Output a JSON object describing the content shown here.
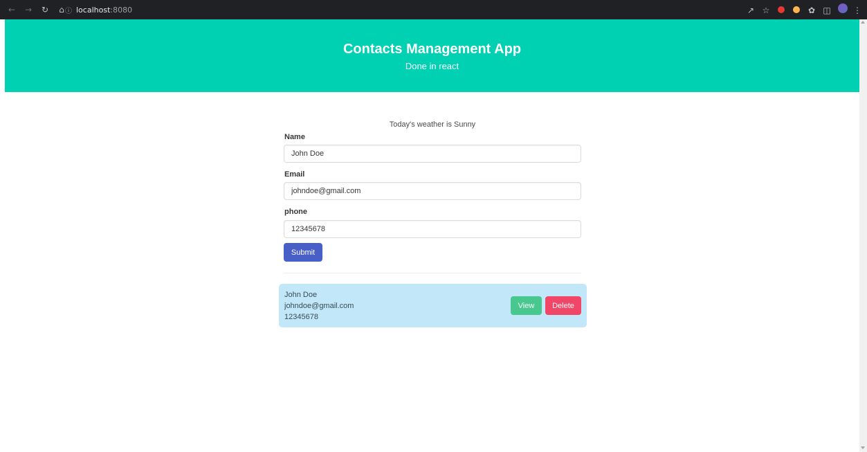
{
  "browser": {
    "url_host": "localhost",
    "url_port": ":8080",
    "icons": {
      "back": "arrow-left-icon",
      "forward": "arrow-right-icon",
      "reload": "reload-icon",
      "home": "home-icon",
      "info": "info-icon",
      "share": "share-icon",
      "bookmark": "star-icon",
      "extensions": "puzzle-icon",
      "sidepanel": "side-panel-icon",
      "menu": "kebab-menu-icon"
    }
  },
  "header": {
    "title": "Contacts Management App",
    "subtitle": "Done in react"
  },
  "weather": "Today's weather is Sunny",
  "form": {
    "name_label": "Name",
    "name_value": "John Doe",
    "email_label": "Email",
    "email_value": "johndoe@gmail.com",
    "phone_label": "phone",
    "phone_value": "12345678",
    "submit_label": "Submit"
  },
  "contacts": [
    {
      "name": "John Doe",
      "email": "johndoe@gmail.com",
      "phone": "12345678",
      "view_label": "View",
      "delete_label": "Delete"
    }
  ],
  "colors": {
    "hero": "#00d1b2",
    "submit": "#485fc7",
    "card": "#c1e7f8",
    "view": "#48c78e",
    "delete": "#f14668"
  }
}
